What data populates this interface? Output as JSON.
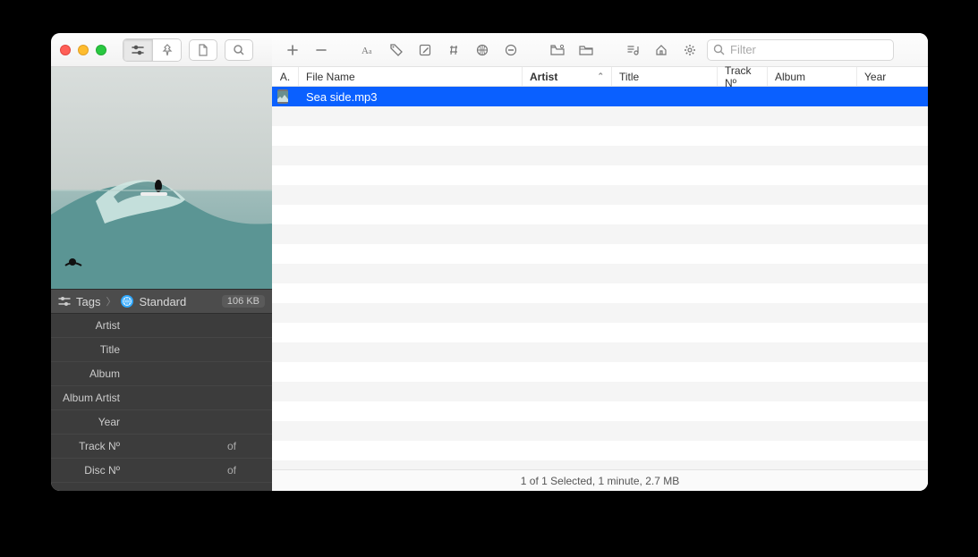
{
  "sidebar": {
    "tags_label": "Tags",
    "standard_label": "Standard",
    "file_size": "106 KB",
    "fields": [
      {
        "k": "Artist",
        "v": "",
        "of": ""
      },
      {
        "k": "Title",
        "v": "",
        "of": ""
      },
      {
        "k": "Album",
        "v": "",
        "of": ""
      },
      {
        "k": "Album Artist",
        "v": "",
        "of": ""
      },
      {
        "k": "Year",
        "v": "",
        "of": ""
      },
      {
        "k": "Track Nº",
        "v": "",
        "of": "of"
      },
      {
        "k": "Disc Nº",
        "v": "",
        "of": "of"
      }
    ]
  },
  "toolbar": {
    "filter_placeholder": "Filter"
  },
  "columns": {
    "art": "A.",
    "file": "File Name",
    "artist": "Artist",
    "title": "Title",
    "track": "Track Nº",
    "album": "Album",
    "year": "Year",
    "sorted": "artist"
  },
  "rows": [
    {
      "file": "Sea side.mp3",
      "artist": "",
      "title": "",
      "track": "",
      "album": "",
      "year": "",
      "selected": true
    }
  ],
  "status": "1 of 1 Selected, 1 minute, 2.7 MB"
}
